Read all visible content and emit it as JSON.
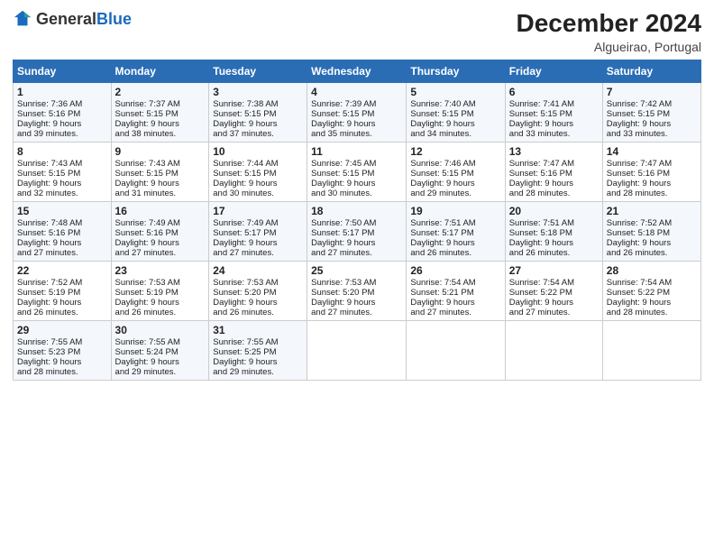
{
  "header": {
    "logo_general": "General",
    "logo_blue": "Blue",
    "month_year": "December 2024",
    "location": "Algueirao, Portugal"
  },
  "days_of_week": [
    "Sunday",
    "Monday",
    "Tuesday",
    "Wednesday",
    "Thursday",
    "Friday",
    "Saturday"
  ],
  "weeks": [
    [
      {
        "day": "1",
        "lines": [
          "Sunrise: 7:36 AM",
          "Sunset: 5:16 PM",
          "Daylight: 9 hours",
          "and 39 minutes."
        ]
      },
      {
        "day": "2",
        "lines": [
          "Sunrise: 7:37 AM",
          "Sunset: 5:15 PM",
          "Daylight: 9 hours",
          "and 38 minutes."
        ]
      },
      {
        "day": "3",
        "lines": [
          "Sunrise: 7:38 AM",
          "Sunset: 5:15 PM",
          "Daylight: 9 hours",
          "and 37 minutes."
        ]
      },
      {
        "day": "4",
        "lines": [
          "Sunrise: 7:39 AM",
          "Sunset: 5:15 PM",
          "Daylight: 9 hours",
          "and 35 minutes."
        ]
      },
      {
        "day": "5",
        "lines": [
          "Sunrise: 7:40 AM",
          "Sunset: 5:15 PM",
          "Daylight: 9 hours",
          "and 34 minutes."
        ]
      },
      {
        "day": "6",
        "lines": [
          "Sunrise: 7:41 AM",
          "Sunset: 5:15 PM",
          "Daylight: 9 hours",
          "and 33 minutes."
        ]
      },
      {
        "day": "7",
        "lines": [
          "Sunrise: 7:42 AM",
          "Sunset: 5:15 PM",
          "Daylight: 9 hours",
          "and 33 minutes."
        ]
      }
    ],
    [
      {
        "day": "8",
        "lines": [
          "Sunrise: 7:43 AM",
          "Sunset: 5:15 PM",
          "Daylight: 9 hours",
          "and 32 minutes."
        ]
      },
      {
        "day": "9",
        "lines": [
          "Sunrise: 7:43 AM",
          "Sunset: 5:15 PM",
          "Daylight: 9 hours",
          "and 31 minutes."
        ]
      },
      {
        "day": "10",
        "lines": [
          "Sunrise: 7:44 AM",
          "Sunset: 5:15 PM",
          "Daylight: 9 hours",
          "and 30 minutes."
        ]
      },
      {
        "day": "11",
        "lines": [
          "Sunrise: 7:45 AM",
          "Sunset: 5:15 PM",
          "Daylight: 9 hours",
          "and 30 minutes."
        ]
      },
      {
        "day": "12",
        "lines": [
          "Sunrise: 7:46 AM",
          "Sunset: 5:15 PM",
          "Daylight: 9 hours",
          "and 29 minutes."
        ]
      },
      {
        "day": "13",
        "lines": [
          "Sunrise: 7:47 AM",
          "Sunset: 5:16 PM",
          "Daylight: 9 hours",
          "and 28 minutes."
        ]
      },
      {
        "day": "14",
        "lines": [
          "Sunrise: 7:47 AM",
          "Sunset: 5:16 PM",
          "Daylight: 9 hours",
          "and 28 minutes."
        ]
      }
    ],
    [
      {
        "day": "15",
        "lines": [
          "Sunrise: 7:48 AM",
          "Sunset: 5:16 PM",
          "Daylight: 9 hours",
          "and 27 minutes."
        ]
      },
      {
        "day": "16",
        "lines": [
          "Sunrise: 7:49 AM",
          "Sunset: 5:16 PM",
          "Daylight: 9 hours",
          "and 27 minutes."
        ]
      },
      {
        "day": "17",
        "lines": [
          "Sunrise: 7:49 AM",
          "Sunset: 5:17 PM",
          "Daylight: 9 hours",
          "and 27 minutes."
        ]
      },
      {
        "day": "18",
        "lines": [
          "Sunrise: 7:50 AM",
          "Sunset: 5:17 PM",
          "Daylight: 9 hours",
          "and 27 minutes."
        ]
      },
      {
        "day": "19",
        "lines": [
          "Sunrise: 7:51 AM",
          "Sunset: 5:17 PM",
          "Daylight: 9 hours",
          "and 26 minutes."
        ]
      },
      {
        "day": "20",
        "lines": [
          "Sunrise: 7:51 AM",
          "Sunset: 5:18 PM",
          "Daylight: 9 hours",
          "and 26 minutes."
        ]
      },
      {
        "day": "21",
        "lines": [
          "Sunrise: 7:52 AM",
          "Sunset: 5:18 PM",
          "Daylight: 9 hours",
          "and 26 minutes."
        ]
      }
    ],
    [
      {
        "day": "22",
        "lines": [
          "Sunrise: 7:52 AM",
          "Sunset: 5:19 PM",
          "Daylight: 9 hours",
          "and 26 minutes."
        ]
      },
      {
        "day": "23",
        "lines": [
          "Sunrise: 7:53 AM",
          "Sunset: 5:19 PM",
          "Daylight: 9 hours",
          "and 26 minutes."
        ]
      },
      {
        "day": "24",
        "lines": [
          "Sunrise: 7:53 AM",
          "Sunset: 5:20 PM",
          "Daylight: 9 hours",
          "and 26 minutes."
        ]
      },
      {
        "day": "25",
        "lines": [
          "Sunrise: 7:53 AM",
          "Sunset: 5:20 PM",
          "Daylight: 9 hours",
          "and 27 minutes."
        ]
      },
      {
        "day": "26",
        "lines": [
          "Sunrise: 7:54 AM",
          "Sunset: 5:21 PM",
          "Daylight: 9 hours",
          "and 27 minutes."
        ]
      },
      {
        "day": "27",
        "lines": [
          "Sunrise: 7:54 AM",
          "Sunset: 5:22 PM",
          "Daylight: 9 hours",
          "and 27 minutes."
        ]
      },
      {
        "day": "28",
        "lines": [
          "Sunrise: 7:54 AM",
          "Sunset: 5:22 PM",
          "Daylight: 9 hours",
          "and 28 minutes."
        ]
      }
    ],
    [
      {
        "day": "29",
        "lines": [
          "Sunrise: 7:55 AM",
          "Sunset: 5:23 PM",
          "Daylight: 9 hours",
          "and 28 minutes."
        ]
      },
      {
        "day": "30",
        "lines": [
          "Sunrise: 7:55 AM",
          "Sunset: 5:24 PM",
          "Daylight: 9 hours",
          "and 29 minutes."
        ]
      },
      {
        "day": "31",
        "lines": [
          "Sunrise: 7:55 AM",
          "Sunset: 5:25 PM",
          "Daylight: 9 hours",
          "and 29 minutes."
        ]
      },
      null,
      null,
      null,
      null
    ]
  ]
}
